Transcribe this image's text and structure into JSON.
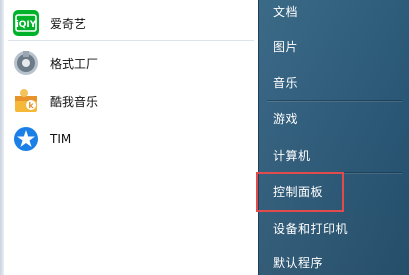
{
  "start_menu": {
    "apps": [
      {
        "label": "爱奇艺",
        "icon": "iqiyi-icon"
      },
      {
        "label": "格式工厂",
        "icon": "format-factory-icon"
      },
      {
        "label": "酷我音乐",
        "icon": "kuwo-music-icon"
      },
      {
        "label": "TIM",
        "icon": "tim-icon"
      }
    ],
    "system_items": [
      {
        "label": "文档"
      },
      {
        "label": "图片"
      },
      {
        "label": "音乐"
      },
      {
        "label": "游戏"
      },
      {
        "label": "计算机"
      },
      {
        "label": "控制面板"
      },
      {
        "label": "设备和打印机"
      },
      {
        "label": "默认程序"
      }
    ],
    "highlighted_item": "控制面板",
    "colors": {
      "right_panel": "#2b5b7b",
      "highlight": "#e24b4b",
      "iqiyi_green": "#00b22a",
      "tim_blue": "#1a7fe6"
    }
  }
}
